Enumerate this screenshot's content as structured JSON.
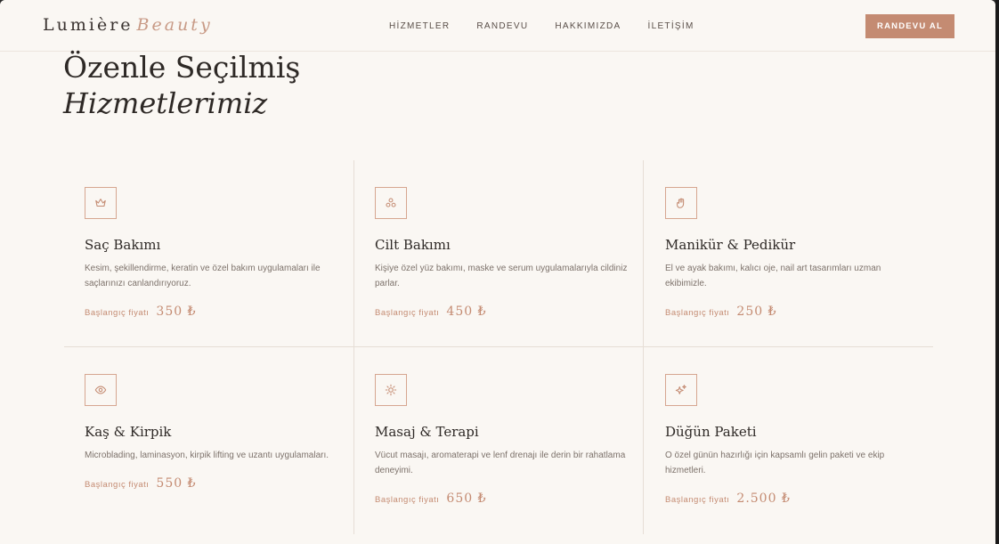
{
  "brand": {
    "name": "Lumière",
    "accent": "Beauty"
  },
  "nav": {
    "items": [
      {
        "label": "HİZMETLER"
      },
      {
        "label": "RANDEVU"
      },
      {
        "label": "HAKKIMIZDA"
      },
      {
        "label": "İLETİŞİM"
      }
    ],
    "cta_label": "RANDEVU AL"
  },
  "section": {
    "title_line1": "Özenle Seçilmiş",
    "title_line2": "Hizmetlerimiz"
  },
  "services": [
    {
      "icon": "crown-icon",
      "title": "Saç Bakımı",
      "description": "Kesim, şekillendirme, keratin ve özel bakım uygulamaları ile saçlarınızı canlandırıyoruz.",
      "price_label": "Başlangıç fiyatı",
      "price": "350 ₺"
    },
    {
      "icon": "flower-icon",
      "title": "Cilt Bakımı",
      "description": "Kişiye özel yüz bakımı, maske ve serum uygulamalarıyla cildiniz parlar.",
      "price_label": "Başlangıç fiyatı",
      "price": "450 ₺"
    },
    {
      "icon": "hand-icon",
      "title": "Manikür & Pedikür",
      "description": "El ve ayak bakımı, kalıcı oje, nail art tasarımları uzman ekibimizle.",
      "price_label": "Başlangıç fiyatı",
      "price": "250 ₺"
    },
    {
      "icon": "eye-icon",
      "title": "Kaş & Kirpik",
      "description": "Microblading, laminasyon, kirpik lifting ve uzantı uygulamaları.",
      "price_label": "Başlangıç fiyatı",
      "price": "550 ₺"
    },
    {
      "icon": "sun-icon",
      "title": "Masaj & Terapi",
      "description": "Vücut masajı, aromaterapi ve lenf drenajı ile derin bir rahatlama deneyimi.",
      "price_label": "Başlangıç fiyatı",
      "price": "650 ₺"
    },
    {
      "icon": "sparkles-icon",
      "title": "Düğün Paketi",
      "description": "O özel günün hazırlığı için kapsamlı gelin paketi ve ekip hizmetleri.",
      "price_label": "Başlangıç fiyatı",
      "price": "2.500 ₺"
    }
  ],
  "colors": {
    "accent": "#c48b72",
    "background": "#faf7f3",
    "text": "#2e2926",
    "muted": "#7d726b"
  }
}
